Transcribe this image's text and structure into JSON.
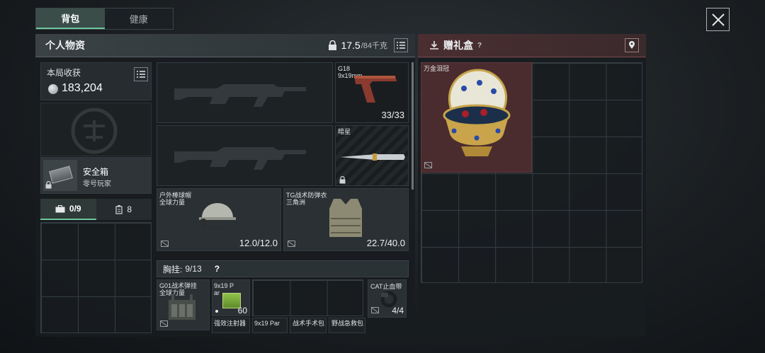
{
  "tabs": [
    {
      "label": "背包"
    },
    {
      "label": "健康"
    }
  ],
  "personal": {
    "title": "个人物资",
    "weight": "17.5",
    "capacity": "/84千克"
  },
  "haul": {
    "label": "本局收获",
    "value": "183,204"
  },
  "safebox": {
    "name": "安全箱",
    "owner": "零号玩家"
  },
  "counters": {
    "bag": "0/9",
    "other": "8"
  },
  "weapons": {
    "pistol_name": "G18",
    "pistol_ammo": "9x19mm",
    "pistol_count": "33/33",
    "melee_name": "暗星"
  },
  "helmet": {
    "name": "户外棒球帽",
    "quality": "全球力量",
    "durability": "12.0/12.0"
  },
  "armor": {
    "name": "TG战术防弹衣",
    "quality": "三角洲",
    "durability": "22.7/40.0"
  },
  "chest": {
    "label": "胸挂:",
    "value": "9/13",
    "help": "?"
  },
  "rig": {
    "name": "G01战术弹挂",
    "quality": "全球力量",
    "items": [
      {
        "label": "9x19 Par",
        "count": "60"
      },
      {
        "label": "强效注射器"
      },
      {
        "label": "9x19 Par"
      },
      {
        "label": "战术手术包"
      },
      {
        "label": "野战急救包"
      }
    ]
  },
  "cat": {
    "label": "CAT止血带",
    "count": "4/4"
  },
  "gift": {
    "title": "赠礼盒",
    "help": "?",
    "item": "万金泪冠"
  },
  "icons": [
    "close-icon",
    "lock-icon",
    "list-icon",
    "download-icon",
    "pin-icon",
    "coin-icon",
    "briefcase-icon",
    "canister-icon",
    "slot-icon"
  ],
  "colors": {
    "accent": "#6fc49c",
    "gift": "#7a4448"
  }
}
